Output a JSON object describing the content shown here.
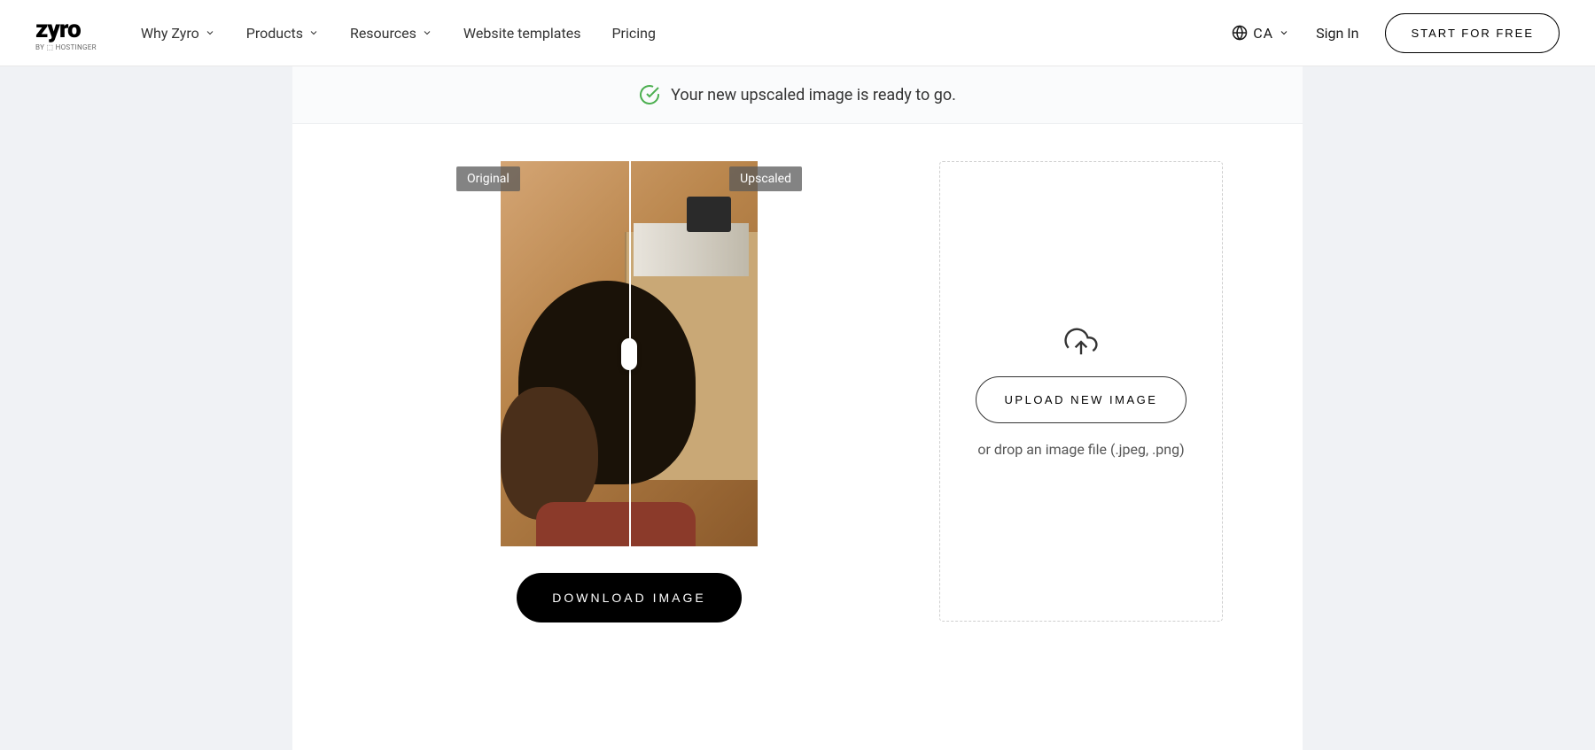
{
  "header": {
    "logo_main": "zyro",
    "logo_sub": "BY ⬚ HOSTINGER",
    "nav": {
      "why": "Why Zyro",
      "products": "Products",
      "resources": "Resources",
      "templates": "Website templates",
      "pricing": "Pricing"
    },
    "locale": "CA",
    "signin": "Sign In",
    "cta": "START FOR FREE"
  },
  "status": {
    "message": "Your new upscaled image is ready to go."
  },
  "comparison": {
    "label_original": "Original",
    "label_upscaled": "Upscaled"
  },
  "download_button": "DOWNLOAD IMAGE",
  "upload": {
    "button": "UPLOAD NEW IMAGE",
    "drop_text": "or drop an image file (.jpeg, .png)"
  }
}
